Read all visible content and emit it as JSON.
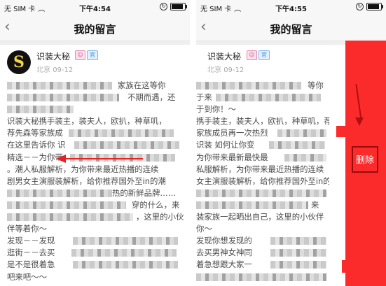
{
  "screens": [
    {
      "status": {
        "carrier": "无 SIM 卡",
        "time": "下午4:54",
        "battery_level": 0.85
      },
      "nav": {
        "title": "我的留言"
      },
      "post": {
        "username": "识装大秘",
        "badges": [
          "☺",
          "官"
        ],
        "location": "北京",
        "date": "09-12",
        "lines": [
          "家族在这等你",
          "不期而遇，还",
          "",
          "识装大秘携手装主，装夫人，欧扒，种草叽，",
          "荐先森等家族成",
          "在这里告诉你 识",
          "精选－－为你带",
          "。潮人私服解析，为你带来最近热播的连续",
          "剧男女主演服装解析，给你推荐国外至in的潮",
          "热的新鲜品牌……",
          "穿的什么，来",
          "，这里的小伙",
          "伴等着你～",
          "发现－－发现",
          "逛街－－去买",
          "是不是很着急",
          "吧来吧～～"
        ]
      }
    },
    {
      "status": {
        "carrier": "无 SIM 卡",
        "time": "下午4:55",
        "battery_level": 0.85
      },
      "nav": {
        "title": "我的留言"
      },
      "post": {
        "username": "识装大秘",
        "badges": [
          "☺",
          "官"
        ],
        "location": "北京",
        "date": "09-12",
        "lines": [
          "等你",
          "于来",
          "于到你！～",
          "携手装主，装夫人，欧扒，种草叽，荐",
          "家族成员再一次热烈",
          "识装 如何让你变",
          "为你带来最新最快最",
          "私服解析，为你带来最近热播的连续",
          "女主演服装解析，给你推荐国外至in的潮",
          "",
          "来",
          "装家族一起晒出自己，这里的小伙伴",
          "你～",
          "发现你想发现的",
          "去买男神女神同",
          "着急想跟大家一",
          ""
        ]
      },
      "action": {
        "delete_label": "删除"
      }
    }
  ]
}
